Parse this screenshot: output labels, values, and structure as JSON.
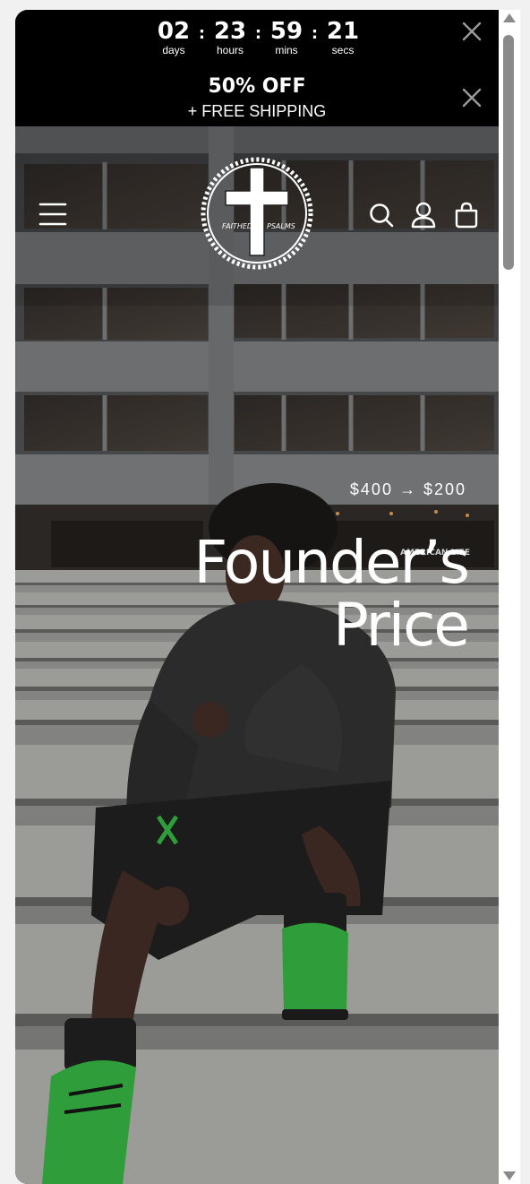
{
  "countdown": {
    "days": "02",
    "days_label": "days",
    "hours": "23",
    "hours_label": "hours",
    "mins": "59",
    "mins_label": "mins",
    "secs": "21",
    "secs_label": "secs",
    "separator": ":"
  },
  "promo": {
    "title": "50% OFF",
    "subtitle": "+ FREE SHIPPING"
  },
  "hero": {
    "price": "$400 → $200",
    "headline_line1": "Founder’s",
    "headline_line2": "Price",
    "building_sign": "AMERICAN LIFE"
  },
  "logo": {
    "text_left": "FAITHED",
    "text_right": "PSALMS"
  },
  "icons": {
    "menu": "hamburger-menu-icon",
    "search": "search-icon",
    "account": "user-icon",
    "cart": "shopping-bag-icon",
    "close": "close-icon"
  },
  "colors": {
    "bar_background": "#000000",
    "text": "#ffffff",
    "sneaker_accent": "#2f9e3a"
  }
}
